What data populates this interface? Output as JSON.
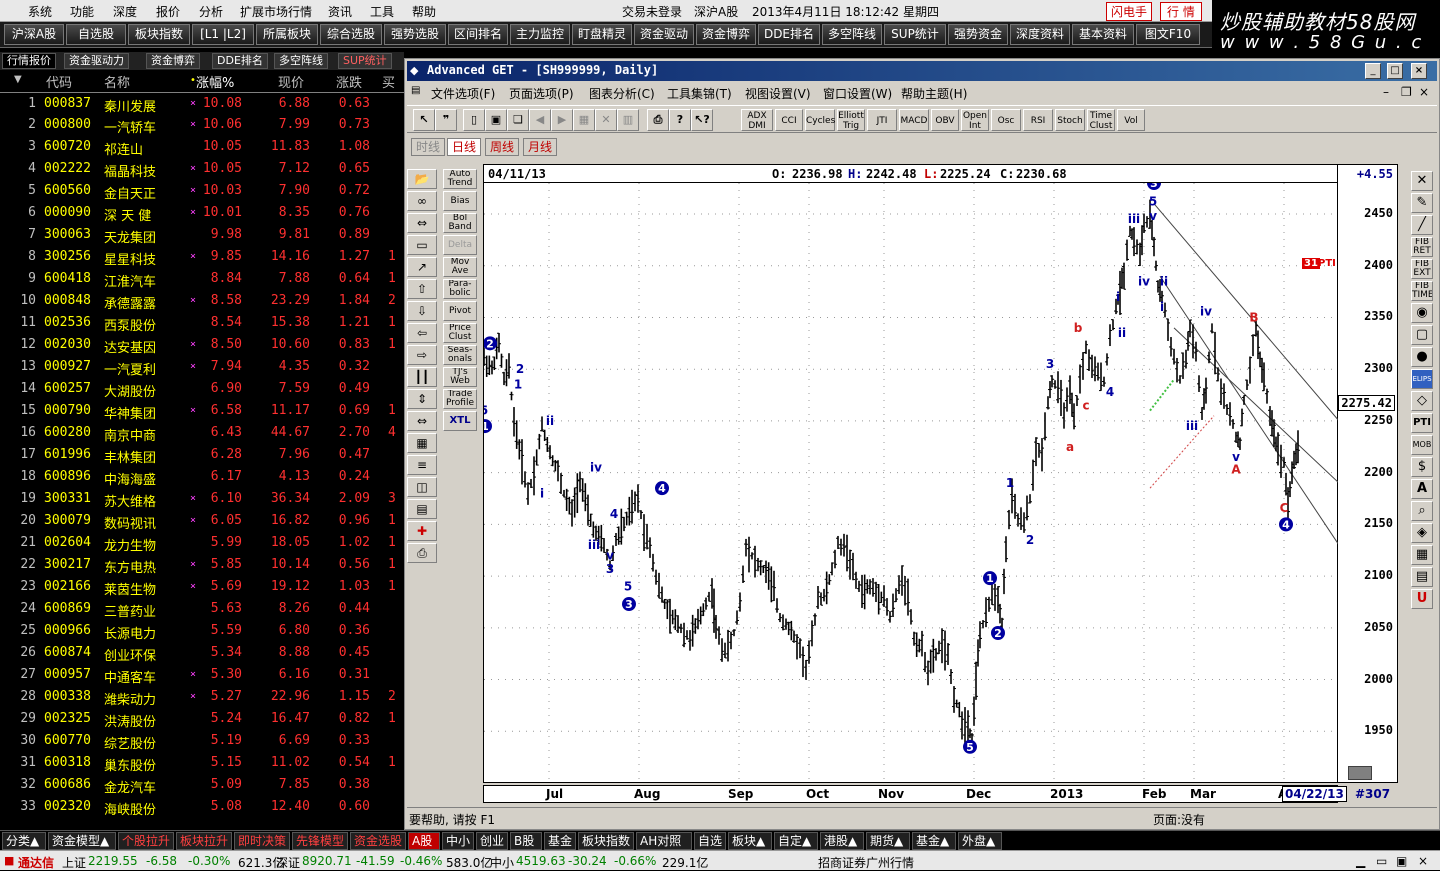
{
  "menubar": {
    "items": [
      "系统",
      "功能",
      "深度",
      "报价",
      "分析",
      "扩展市场行情",
      "资讯",
      "工具",
      "帮助"
    ],
    "center": "交易未登录",
    "market": "深沪A股",
    "datetime": "2013年4月11日  18:12:42  星期四",
    "btn_flash": "闪电手",
    "btn_quote": "行 情"
  },
  "logo": {
    "line1": "炒股辅助教材58股网",
    "line2": "w w w . 5 8 G u . c o m"
  },
  "toolbar": [
    "沪深A股",
    "自选股",
    "板块指数",
    "[L1 |L2]",
    "所属板块",
    "综合选股",
    "强势选股",
    "区间排名",
    "主力监控",
    "盯盘精灵",
    "资金驱动",
    "资金博弈",
    "DDE排名",
    "多空阵线",
    "SUP统计",
    "强势资金",
    "深度资料",
    "基本资料",
    "图文F10"
  ],
  "left_tabs": [
    "行情报价",
    "资金驱动力",
    "资金博弈",
    "DDE排名",
    "多空阵线",
    "SUP统计"
  ],
  "list_header": {
    "code": "代码",
    "name": "名称",
    "pct": "涨幅%",
    "price": "现价",
    "change": "涨跌",
    "buy": "买"
  },
  "stocks": [
    {
      "n": "1",
      "code": "000837",
      "name": "秦川发展",
      "mark": "×",
      "pct": "10.08",
      "price": "6.88",
      "chg": "0.63",
      "ex": ""
    },
    {
      "n": "2",
      "code": "000800",
      "name": "一汽轿车",
      "mark": "×",
      "pct": "10.06",
      "price": "7.99",
      "chg": "0.73",
      "ex": ""
    },
    {
      "n": "3",
      "code": "600720",
      "name": "祁连山",
      "mark": "",
      "pct": "10.05",
      "price": "11.83",
      "chg": "1.08",
      "ex": ""
    },
    {
      "n": "4",
      "code": "002222",
      "name": "福晶科技",
      "mark": "×",
      "pct": "10.05",
      "price": "7.12",
      "chg": "0.65",
      "ex": ""
    },
    {
      "n": "5",
      "code": "600560",
      "name": "金自天正",
      "mark": "×",
      "pct": "10.03",
      "price": "7.90",
      "chg": "0.72",
      "ex": ""
    },
    {
      "n": "6",
      "code": "000090",
      "name": "深 天 健",
      "mark": "×",
      "pct": "10.01",
      "price": "8.35",
      "chg": "0.76",
      "ex": ""
    },
    {
      "n": "7",
      "code": "300063",
      "name": "天龙集团",
      "mark": "",
      "pct": "9.98",
      "price": "9.81",
      "chg": "0.89",
      "ex": ""
    },
    {
      "n": "8",
      "code": "300256",
      "name": "星星科技",
      "mark": "×",
      "pct": "9.85",
      "price": "14.16",
      "chg": "1.27",
      "ex": "1"
    },
    {
      "n": "9",
      "code": "600418",
      "name": "江淮汽车",
      "mark": "",
      "pct": "8.84",
      "price": "7.88",
      "chg": "0.64",
      "ex": "1"
    },
    {
      "n": "10",
      "code": "000848",
      "name": "承德露露",
      "mark": "×",
      "pct": "8.58",
      "price": "23.29",
      "chg": "1.84",
      "ex": "2"
    },
    {
      "n": "11",
      "code": "002536",
      "name": "西泵股份",
      "mark": "",
      "pct": "8.54",
      "price": "15.38",
      "chg": "1.21",
      "ex": "1"
    },
    {
      "n": "12",
      "code": "002030",
      "name": "达安基因",
      "mark": "×",
      "pct": "8.50",
      "price": "10.60",
      "chg": "0.83",
      "ex": "1"
    },
    {
      "n": "13",
      "code": "000927",
      "name": "一汽夏利",
      "mark": "×",
      "pct": "7.94",
      "price": "4.35",
      "chg": "0.32",
      "ex": ""
    },
    {
      "n": "14",
      "code": "600257",
      "name": "大湖股份",
      "mark": "",
      "pct": "6.90",
      "price": "7.59",
      "chg": "0.49",
      "ex": ""
    },
    {
      "n": "15",
      "code": "000790",
      "name": "华神集团",
      "mark": "×",
      "pct": "6.58",
      "price": "11.17",
      "chg": "0.69",
      "ex": "1"
    },
    {
      "n": "16",
      "code": "600280",
      "name": "南京中商",
      "mark": "",
      "pct": "6.43",
      "price": "44.67",
      "chg": "2.70",
      "ex": "4"
    },
    {
      "n": "17",
      "code": "601996",
      "name": "丰林集团",
      "mark": "",
      "pct": "6.28",
      "price": "7.96",
      "chg": "0.47",
      "ex": ""
    },
    {
      "n": "18",
      "code": "600896",
      "name": "中海海盛",
      "mark": "",
      "pct": "6.17",
      "price": "4.13",
      "chg": "0.24",
      "ex": ""
    },
    {
      "n": "19",
      "code": "300331",
      "name": "苏大维格",
      "mark": "×",
      "pct": "6.10",
      "price": "36.34",
      "chg": "2.09",
      "ex": "3"
    },
    {
      "n": "20",
      "code": "300079",
      "name": "数码视讯",
      "mark": "×",
      "pct": "6.05",
      "price": "16.82",
      "chg": "0.96",
      "ex": "1"
    },
    {
      "n": "21",
      "code": "002604",
      "name": "龙力生物",
      "mark": "",
      "pct": "5.99",
      "price": "18.05",
      "chg": "1.02",
      "ex": "1"
    },
    {
      "n": "22",
      "code": "300217",
      "name": "东方电热",
      "mark": "×",
      "pct": "5.85",
      "price": "10.14",
      "chg": "0.56",
      "ex": "1"
    },
    {
      "n": "23",
      "code": "002166",
      "name": "莱茵生物",
      "mark": "×",
      "pct": "5.69",
      "price": "19.12",
      "chg": "1.03",
      "ex": "1"
    },
    {
      "n": "24",
      "code": "600869",
      "name": "三普药业",
      "mark": "",
      "pct": "5.63",
      "price": "8.26",
      "chg": "0.44",
      "ex": ""
    },
    {
      "n": "25",
      "code": "000966",
      "name": "长源电力",
      "mark": "",
      "pct": "5.59",
      "price": "6.80",
      "chg": "0.36",
      "ex": ""
    },
    {
      "n": "26",
      "code": "600874",
      "name": "创业环保",
      "mark": "",
      "pct": "5.34",
      "price": "8.88",
      "chg": "0.45",
      "ex": ""
    },
    {
      "n": "27",
      "code": "000957",
      "name": "中通客车",
      "mark": "×",
      "pct": "5.30",
      "price": "6.16",
      "chg": "0.31",
      "ex": ""
    },
    {
      "n": "28",
      "code": "000338",
      "name": "潍柴动力",
      "mark": "×",
      "pct": "5.27",
      "price": "22.96",
      "chg": "1.15",
      "ex": "2"
    },
    {
      "n": "29",
      "code": "002325",
      "name": "洪涛股份",
      "mark": "",
      "pct": "5.24",
      "price": "16.47",
      "chg": "0.82",
      "ex": "1"
    },
    {
      "n": "30",
      "code": "600770",
      "name": "综艺股份",
      "mark": "",
      "pct": "5.19",
      "price": "6.69",
      "chg": "0.33",
      "ex": ""
    },
    {
      "n": "31",
      "code": "600318",
      "name": "巢东股份",
      "mark": "",
      "pct": "5.15",
      "price": "11.02",
      "chg": "0.54",
      "ex": "1"
    },
    {
      "n": "32",
      "code": "600686",
      "name": "金龙汽车",
      "mark": "",
      "pct": "5.09",
      "price": "7.85",
      "chg": "0.38",
      "ex": ""
    },
    {
      "n": "33",
      "code": "002320",
      "name": "海峡股份",
      "mark": "",
      "pct": "5.08",
      "price": "12.40",
      "chg": "0.60",
      "ex": ""
    }
  ],
  "window": {
    "title": "Advanced GET - [SH999999, Daily]",
    "menu": [
      "文件选项(F)",
      "页面选项(P)",
      "图表分析(C)",
      "工具集锦(T)",
      "视图设置(V)",
      "窗口设置(W)",
      "帮助主题(H)"
    ],
    "indicators": [
      "ADX DMI",
      "CCI",
      "Cycles",
      "Elliott Trig",
      "JTI",
      "MACD",
      "OBV",
      "Open Int",
      "Osc",
      "RSI",
      "Stoch",
      "Time Clust",
      "Vol"
    ],
    "period_tabs": [
      "时线",
      "日线",
      "周线",
      "月线"
    ],
    "side_buttons": [
      "Auto Trend",
      "Bias",
      "Bol Band",
      "Delta",
      "Mov Ave",
      "Para- bolic",
      "Pivot",
      "Price Clust",
      "Seas- onals",
      "TJ's Web",
      "Trade Profile",
      "XTL"
    ],
    "left_icons": [
      "open-icon",
      "zoom-icon",
      "reset-icon",
      "study-icon",
      "elliott-icon",
      "up-icon",
      "down-icon",
      "left-icon",
      "right-icon",
      "bars-icon",
      "scale-icon",
      "spread-icon",
      "grid-icon",
      "lines-icon",
      "gann-icon",
      "fib-icon",
      "cross-icon",
      "print-icon"
    ],
    "right_icons": [
      "close-x-icon",
      "pencil-icon",
      "line-icon",
      "fib-ret-icon",
      "fib-ext-icon",
      "fib-time-icon",
      "ellipse-icon",
      "box-icon",
      "circle-icon",
      "ellipse-tool-icon",
      "eraser-icon",
      "pti-icon",
      "mob-icon",
      "dollar-icon",
      "text-icon",
      "magnify-icon",
      "paint-icon",
      "table-icon",
      "book-icon",
      "magnet-icon"
    ],
    "right_icon_text": [
      "FIB RET",
      "FIB EXT",
      "FIB TIME",
      "ELIPS",
      "PTI",
      "MOB"
    ],
    "status_help": "要帮助, 请按 F1",
    "status_page": "页面:没有"
  },
  "chart_data": {
    "type": "candlestick",
    "info": {
      "date": "04/11/13",
      "o_label": "O:",
      "o": "2236.98",
      "h_label": "H:",
      "h": "2242.48",
      "l_label": "L:",
      "l": "2225.24",
      "c_label": "C:",
      "c": "2230.68",
      "change": "+4.55"
    },
    "current_price": "2275.42",
    "ylim": [
      1900,
      2480
    ],
    "yticks": [
      1950,
      2000,
      2050,
      2100,
      2150,
      2200,
      2250,
      2300,
      2350,
      2400,
      2450
    ],
    "xlabels": [
      "Jul",
      "Aug",
      "Sep",
      "Oct",
      "Nov",
      "Dec",
      "2013",
      "Feb",
      "Mar",
      "A"
    ],
    "last_date": "04/22/13",
    "count": "#307",
    "pti": "31",
    "pti_label": "PTI",
    "path_points": [
      [
        0,
        2310
      ],
      [
        8,
        2300
      ],
      [
        15,
        2325
      ],
      [
        20,
        2290
      ],
      [
        25,
        2300
      ],
      [
        30,
        2250
      ],
      [
        38,
        2210
      ],
      [
        44,
        2180
      ],
      [
        50,
        2200
      ],
      [
        58,
        2245
      ],
      [
        66,
        2220
      ],
      [
        74,
        2200
      ],
      [
        80,
        2180
      ],
      [
        88,
        2160
      ],
      [
        96,
        2195
      ],
      [
        104,
        2160
      ],
      [
        112,
        2140
      ],
      [
        120,
        2130
      ],
      [
        126,
        2110
      ],
      [
        132,
        2135
      ],
      [
        140,
        2150
      ],
      [
        148,
        2165
      ],
      [
        154,
        2175
      ],
      [
        160,
        2145
      ],
      [
        166,
        2130
      ],
      [
        172,
        2100
      ],
      [
        178,
        2080
      ],
      [
        186,
        2060
      ],
      [
        194,
        2055
      ],
      [
        200,
        2045
      ],
      [
        206,
        2040
      ],
      [
        214,
        2055
      ],
      [
        222,
        2075
      ],
      [
        228,
        2085
      ],
      [
        232,
        2050
      ],
      [
        238,
        2030
      ],
      [
        244,
        2030
      ],
      [
        250,
        2045
      ],
      [
        256,
        2075
      ],
      [
        262,
        2130
      ],
      [
        268,
        2120
      ],
      [
        274,
        2110
      ],
      [
        282,
        2105
      ],
      [
        290,
        2085
      ],
      [
        296,
        2060
      ],
      [
        302,
        2055
      ],
      [
        310,
        2040
      ],
      [
        316,
        2030
      ],
      [
        322,
        2010
      ],
      [
        328,
        2040
      ],
      [
        334,
        2080
      ],
      [
        340,
        2080
      ],
      [
        348,
        2105
      ],
      [
        354,
        2130
      ],
      [
        360,
        2130
      ],
      [
        366,
        2115
      ],
      [
        372,
        2095
      ],
      [
        378,
        2085
      ],
      [
        386,
        2090
      ],
      [
        392,
        2085
      ],
      [
        400,
        2080
      ],
      [
        406,
        2060
      ],
      [
        412,
        2080
      ],
      [
        418,
        2100
      ],
      [
        424,
        2080
      ],
      [
        430,
        2040
      ],
      [
        438,
        2030
      ],
      [
        444,
        2010
      ],
      [
        452,
        2025
      ],
      [
        458,
        2035
      ],
      [
        464,
        2020
      ],
      [
        470,
        1985
      ],
      [
        478,
        1960
      ],
      [
        484,
        1955
      ],
      [
        488,
        1945
      ],
      [
        492,
        2000
      ],
      [
        496,
        2045
      ],
      [
        502,
        2060
      ],
      [
        508,
        2085
      ],
      [
        514,
        2080
      ],
      [
        518,
        2055
      ],
      [
        522,
        2130
      ],
      [
        528,
        2175
      ],
      [
        534,
        2155
      ],
      [
        540,
        2150
      ],
      [
        546,
        2175
      ],
      [
        552,
        2220
      ],
      [
        558,
        2220
      ],
      [
        564,
        2270
      ],
      [
        568,
        2290
      ],
      [
        574,
        2280
      ],
      [
        580,
        2260
      ],
      [
        586,
        2275
      ],
      [
        590,
        2250
      ],
      [
        596,
        2290
      ],
      [
        602,
        2320
      ],
      [
        608,
        2300
      ],
      [
        614,
        2295
      ],
      [
        620,
        2290
      ],
      [
        626,
        2330
      ],
      [
        632,
        2360
      ],
      [
        636,
        2375
      ],
      [
        640,
        2395
      ],
      [
        646,
        2435
      ],
      [
        650,
        2425
      ],
      [
        656,
        2410
      ],
      [
        660,
        2440
      ],
      [
        666,
        2445
      ],
      [
        670,
        2420
      ],
      [
        674,
        2380
      ],
      [
        678,
        2370
      ],
      [
        684,
        2340
      ],
      [
        690,
        2310
      ],
      [
        696,
        2290
      ],
      [
        702,
        2310
      ],
      [
        706,
        2340
      ],
      [
        712,
        2315
      ],
      [
        718,
        2255
      ],
      [
        722,
        2280
      ],
      [
        728,
        2340
      ],
      [
        734,
        2295
      ],
      [
        740,
        2270
      ],
      [
        746,
        2255
      ],
      [
        752,
        2235
      ],
      [
        756,
        2230
      ],
      [
        760,
        2270
      ],
      [
        766,
        2300
      ],
      [
        772,
        2340
      ],
      [
        776,
        2310
      ],
      [
        780,
        2290
      ],
      [
        786,
        2255
      ],
      [
        790,
        2240
      ],
      [
        794,
        2220
      ],
      [
        800,
        2210
      ],
      [
        804,
        2170
      ],
      [
        808,
        2200
      ],
      [
        812,
        2220
      ],
      [
        816,
        2230
      ]
    ],
    "elliott_labels": [
      {
        "t": "2",
        "d": 6,
        "p": 2325,
        "circle": true
      },
      {
        "t": "5",
        "d": 0,
        "p": 2260,
        "circle": false
      },
      {
        "t": "1",
        "d": 1,
        "p": 2245,
        "circle": true
      },
      {
        "t": "2",
        "d": 36,
        "p": 2300,
        "circle": false
      },
      {
        "t": "1",
        "d": 34,
        "p": 2285,
        "circle": false
      },
      {
        "t": "i",
        "d": 58,
        "p": 2180,
        "circle": false
      },
      {
        "t": "ii",
        "d": 66,
        "p": 2250,
        "circle": false
      },
      {
        "t": "iv",
        "d": 112,
        "p": 2205,
        "circle": false
      },
      {
        "t": "iii",
        "d": 110,
        "p": 2130,
        "circle": false
      },
      {
        "t": "4",
        "d": 130,
        "p": 2160,
        "circle": false
      },
      {
        "t": "v",
        "d": 126,
        "p": 2120,
        "circle": false
      },
      {
        "t": "3",
        "d": 126,
        "p": 2107,
        "circle": false
      },
      {
        "t": "5",
        "d": 144,
        "p": 2090,
        "circle": false
      },
      {
        "t": "3",
        "d": 145,
        "p": 2073,
        "circle": true
      },
      {
        "t": "4",
        "d": 178,
        "p": 2185,
        "circle": true
      },
      {
        "t": "5",
        "d": 486,
        "p": 1935,
        "circle": true
      },
      {
        "t": "1",
        "d": 506,
        "p": 2098,
        "circle": true
      },
      {
        "t": "2",
        "d": 514,
        "p": 2045,
        "circle": true
      },
      {
        "t": "1",
        "d": 526,
        "p": 2190,
        "circle": false
      },
      {
        "t": "2",
        "d": 546,
        "p": 2135,
        "circle": false
      },
      {
        "t": "a",
        "d": 586,
        "p": 2225,
        "circle": false,
        "red": true
      },
      {
        "t": "3",
        "d": 566,
        "p": 2305,
        "circle": false
      },
      {
        "t": "b",
        "d": 594,
        "p": 2340,
        "circle": false,
        "red": true
      },
      {
        "t": "c",
        "d": 602,
        "p": 2265,
        "circle": false,
        "red": true
      },
      {
        "t": "4",
        "d": 626,
        "p": 2278,
        "circle": false
      },
      {
        "t": "i",
        "d": 634,
        "p": 2370,
        "circle": false
      },
      {
        "t": "ii",
        "d": 638,
        "p": 2335,
        "circle": false
      },
      {
        "t": "iii",
        "d": 650,
        "p": 2445,
        "circle": false
      },
      {
        "t": "iv",
        "d": 660,
        "p": 2385,
        "circle": false
      },
      {
        "t": "3",
        "d": 670,
        "p": 2480,
        "circle": true
      },
      {
        "t": "5",
        "d": 669,
        "p": 2462,
        "circle": false
      },
      {
        "t": "v",
        "d": 669,
        "p": 2448,
        "circle": false
      },
      {
        "t": "ii",
        "d": 680,
        "p": 2385,
        "circle": false
      },
      {
        "t": "i",
        "d": 678,
        "p": 2360,
        "circle": false
      },
      {
        "t": "iii",
        "d": 708,
        "p": 2245,
        "circle": false
      },
      {
        "t": "iv",
        "d": 722,
        "p": 2356,
        "circle": false
      },
      {
        "t": "B",
        "d": 770,
        "p": 2350,
        "circle": false,
        "red": true
      },
      {
        "t": "v",
        "d": 752,
        "p": 2215,
        "circle": false
      },
      {
        "t": "A",
        "d": 752,
        "p": 2203,
        "circle": false,
        "red": true
      },
      {
        "t": "C",
        "d": 800,
        "p": 2166,
        "circle": false,
        "red": true
      },
      {
        "t": "4",
        "d": 802,
        "p": 2150,
        "circle": true
      }
    ]
  },
  "bottom_tabs": [
    "分类▲",
    "资金模型▲",
    "个股拉升",
    "板块拉升",
    "即时决策",
    "先锋模型",
    "资金选股",
    "A股",
    "中小",
    "创业",
    "B股",
    "基金",
    "板块指数",
    "AH对照",
    "自选",
    "板块▲",
    "自定▲",
    "港股▲",
    "期货▲",
    "基金▲",
    "外盘▲"
  ],
  "statusbar": {
    "app": "通达信",
    "sh_label": "上证",
    "sh": "2219.55",
    "sh_chg": "-6.58",
    "sh_pct": "-0.30%",
    "sh_vol": "621.3亿",
    "sz_label": "深证",
    "sz": "8920.71",
    "sz_chg": "-41.59",
    "sz_pct": "-0.46%",
    "sz_vol": "583.0亿",
    "zx_label": "中小",
    "zx": "4519.63",
    "zx_chg": "-30.24",
    "zx_pct": "-0.66%",
    "zx_vol": "229.1亿",
    "broker": "招商证券广州行情"
  }
}
